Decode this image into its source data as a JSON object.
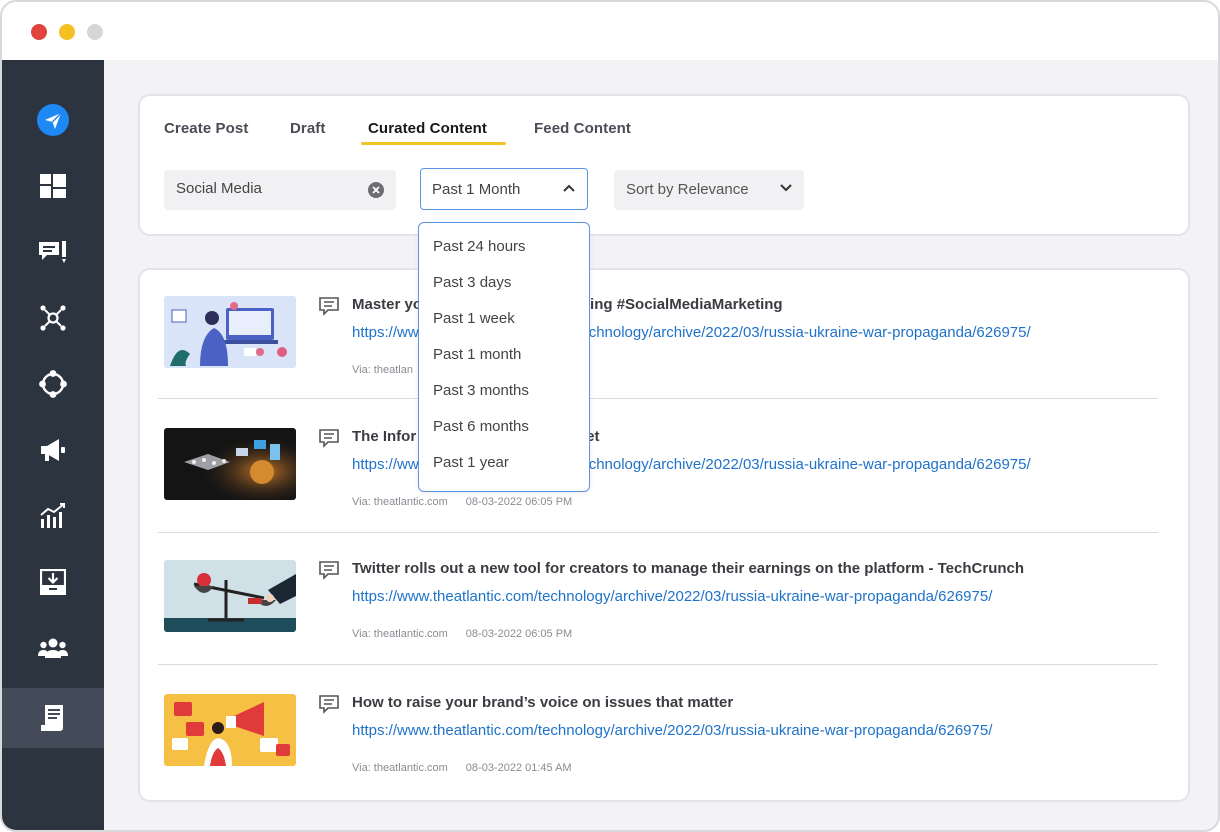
{
  "sidebar": {
    "items": [
      {
        "icon": "send-icon",
        "active": false
      },
      {
        "icon": "dashboard-icon",
        "active": false
      },
      {
        "icon": "comments-icon",
        "active": false
      },
      {
        "icon": "network-icon",
        "active": false
      },
      {
        "icon": "circle-nodes-icon",
        "active": false
      },
      {
        "icon": "megaphone-icon",
        "active": false
      },
      {
        "icon": "analytics-icon",
        "active": false
      },
      {
        "icon": "download-tray-icon",
        "active": false
      },
      {
        "icon": "team-icon",
        "active": false
      },
      {
        "icon": "content-document-icon",
        "active": true
      }
    ]
  },
  "tabs": [
    {
      "label": "Create Post"
    },
    {
      "label": "Draft"
    },
    {
      "label": "Curated Content"
    },
    {
      "label": "Feed Content"
    }
  ],
  "filters": {
    "search_value": "Social Media",
    "time_selected": "Past 1 Month",
    "sort_selected": "Sort by Relevance"
  },
  "time_options": [
    "Past 24 hours",
    "Past 3 days",
    "Past 1 week",
    "Past 1 month",
    "Past 3 months",
    "Past 6 months",
    "Past 1 year"
  ],
  "posts": [
    {
      "title": "Master yo",
      "title_tail": "ing #SocialMediaMarketing",
      "link": "https://ww",
      "link_tail": "chnology/archive/2022/03/russia-ukraine-war-propaganda/626975/",
      "via": "Via: theatlan",
      "date": ""
    },
    {
      "title": "The Infor",
      "title_tail": "et",
      "link": "https://ww",
      "link_tail": "chnology/archive/2022/03/russia-ukraine-war-propaganda/626975/",
      "via": "Via: theatlantic.com",
      "date": "08-03-2022 06:05 PM"
    },
    {
      "title": "Twitter rolls out a new tool for creators to manage their earnings on the platform - TechCrunch",
      "link": "https://www.theatlantic.com/technology/archive/2022/03/russia-ukraine-war-propaganda/626975/",
      "via": "Via: theatlantic.com",
      "date": "08-03-2022 06:05 PM"
    },
    {
      "title": "How to raise your brand’s voice on issues that matter",
      "link": "https://www.theatlantic.com/technology/archive/2022/03/russia-ukraine-war-propaganda/626975/",
      "via": "Via: theatlantic.com",
      "date": "08-03-2022 01:45 AM"
    }
  ],
  "colors": {
    "sidebar_bg": "#2c3440",
    "accent_blue": "#1f72c9",
    "tab_underline": "#f2c42a"
  }
}
